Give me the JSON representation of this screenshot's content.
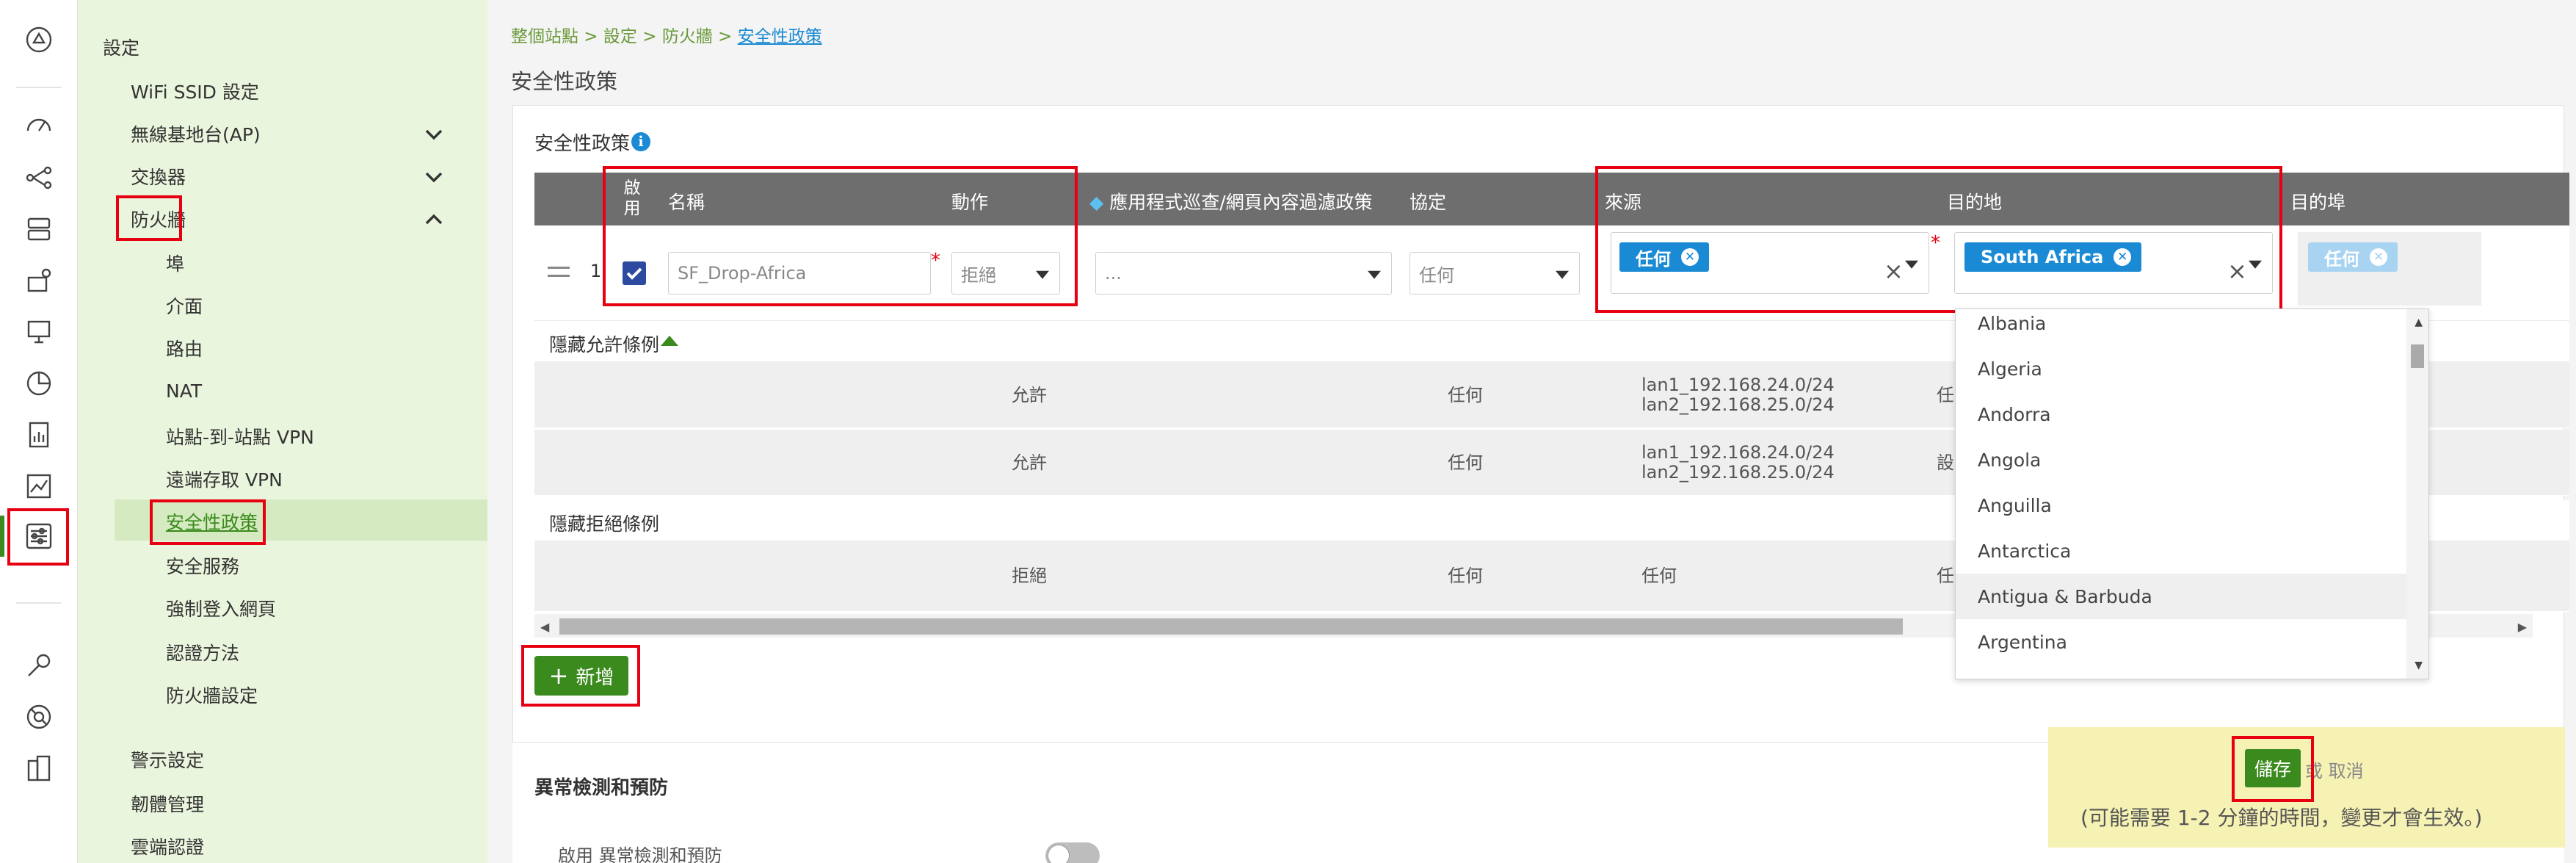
{
  "nav": {
    "heading": "設定",
    "items": [
      {
        "label": "WiFi SSID 設定"
      },
      {
        "label": "無線基地台(AP)"
      },
      {
        "label": "交換器"
      },
      {
        "label": "防火牆"
      },
      {
        "label": "埠"
      },
      {
        "label": "介面"
      },
      {
        "label": "路由"
      },
      {
        "label": "NAT"
      },
      {
        "label": "站點-到-站點 VPN"
      },
      {
        "label": "遠端存取 VPN"
      },
      {
        "label": "安全性政策"
      },
      {
        "label": "安全服務"
      },
      {
        "label": "強制登入網頁"
      },
      {
        "label": "認證方法"
      },
      {
        "label": "防火牆設定"
      },
      {
        "label": "警示設定"
      },
      {
        "label": "韌體管理"
      },
      {
        "label": "雲端認證"
      }
    ]
  },
  "breadcrumb": {
    "part1": "整個站點",
    "sep": " > ",
    "part2": "設定",
    "part3": "防火牆",
    "current": "安全性政策"
  },
  "page_title": "安全性政策",
  "policy_section": {
    "title": "安全性政策",
    "info_glyph": "i",
    "columns": {
      "enable": "啟用",
      "name": "名稱",
      "action": "動作",
      "app_filter": "應用程式巡查/網頁內容過濾政策",
      "protocol": "協定",
      "source": "來源",
      "destination": "目的地",
      "dest_port": "目的埠"
    },
    "row": {
      "index": "1",
      "name_value": "SF_Drop-Africa",
      "action_value": "拒絕",
      "app_filter_value": "...",
      "protocol_value": "任何",
      "source_tag": "任何",
      "destination_tag": "South Africa",
      "dest_port_tag": "任何"
    },
    "hide_allow_label": "隱藏允許條例",
    "allow_rows": [
      {
        "action": "允許",
        "protocol": "任何",
        "src1": "lan1_192.168.24.0/24",
        "src2": "lan2_192.168.25.0/24",
        "dst": "任"
      },
      {
        "action": "允許",
        "protocol": "任何",
        "src1": "lan1_192.168.24.0/24",
        "src2": "lan2_192.168.25.0/24",
        "dst": "設"
      }
    ],
    "hide_deny_label": "隱藏拒絕條例",
    "deny_rows": [
      {
        "action": "拒絕",
        "protocol": "任何",
        "src": "任何",
        "dst": "任"
      }
    ],
    "add_button": "新增",
    "add_glyph": "+"
  },
  "country_options": [
    "Albania",
    "Algeria",
    "Andorra",
    "Angola",
    "Anguilla",
    "Antarctica",
    "Antigua & Barbuda",
    "Argentina"
  ],
  "ids_section": {
    "title": "異常檢測和預防",
    "enable_label": "啟用 異常檢測和預防"
  },
  "save_bar": {
    "save": "儲存",
    "cancel": "或 取消",
    "note": "(可能需要 1-2 分鐘的時間，變更才會生效。)"
  },
  "colors": {
    "accent_green": "#3a8a1d",
    "tag_blue": "#1a8ad4",
    "highlight_red": "#e60012",
    "save_bar_bg": "#f6f2b4"
  }
}
